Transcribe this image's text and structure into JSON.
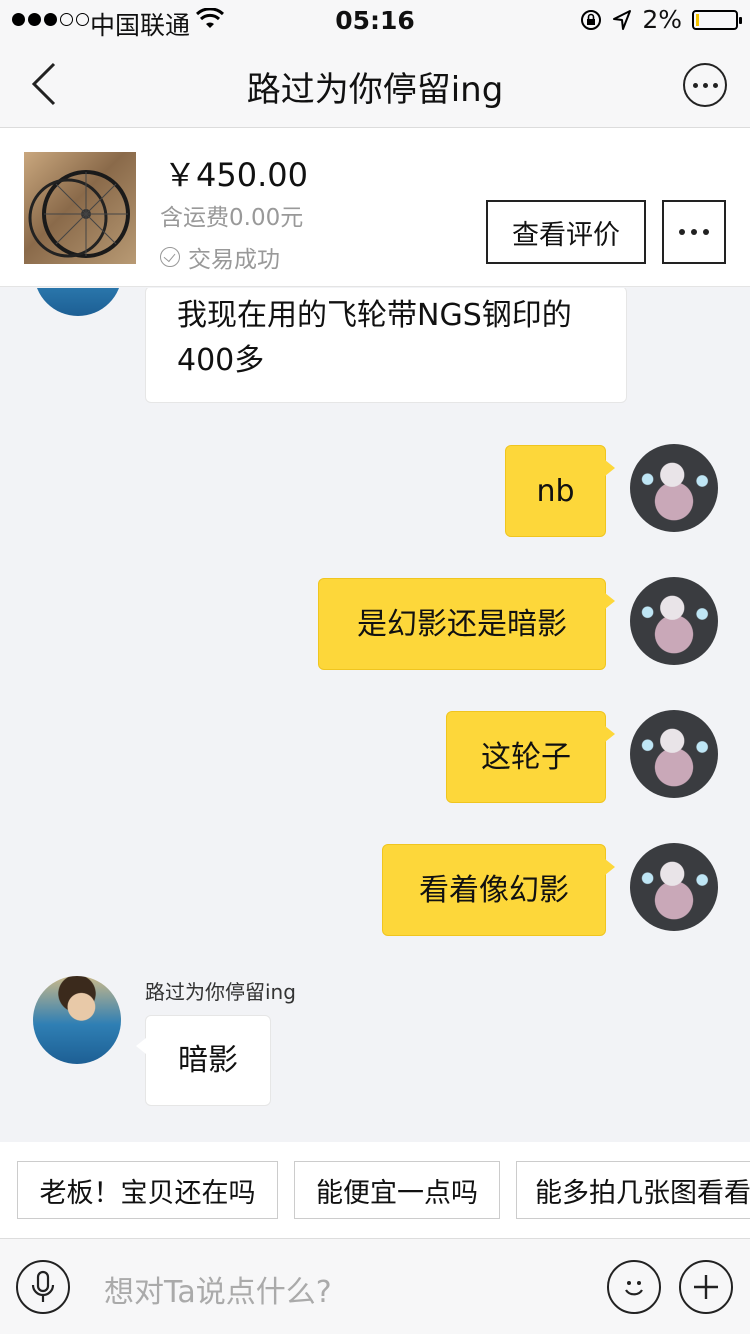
{
  "status_bar": {
    "carrier": "中国联通",
    "time": "05:16",
    "battery": "2%"
  },
  "nav": {
    "title": "路过为你停留ing"
  },
  "product": {
    "price": "￥450.00",
    "shipping": "含运费0.00元",
    "status": "交易成功",
    "review_button": "查看评价"
  },
  "messages": [
    {
      "from": "them",
      "text": "我现在用的飞轮带NGS钢印的400多"
    },
    {
      "from": "me",
      "text": "nb"
    },
    {
      "from": "me",
      "text": "是幻影还是暗影"
    },
    {
      "from": "me",
      "text": "这轮子"
    },
    {
      "from": "me",
      "text": "看着像幻影"
    },
    {
      "from": "them",
      "sender": "路过为你停留ing",
      "text": "暗影"
    }
  ],
  "quick_replies": [
    "老板！宝贝还在吗",
    "能便宜一点吗",
    "能多拍几张图看看"
  ],
  "input": {
    "placeholder": "想对Ta说点什么?"
  },
  "colors": {
    "my_bubble": "#fdd73a",
    "their_bubble": "#ffffff",
    "background": "#f2f3f6"
  }
}
